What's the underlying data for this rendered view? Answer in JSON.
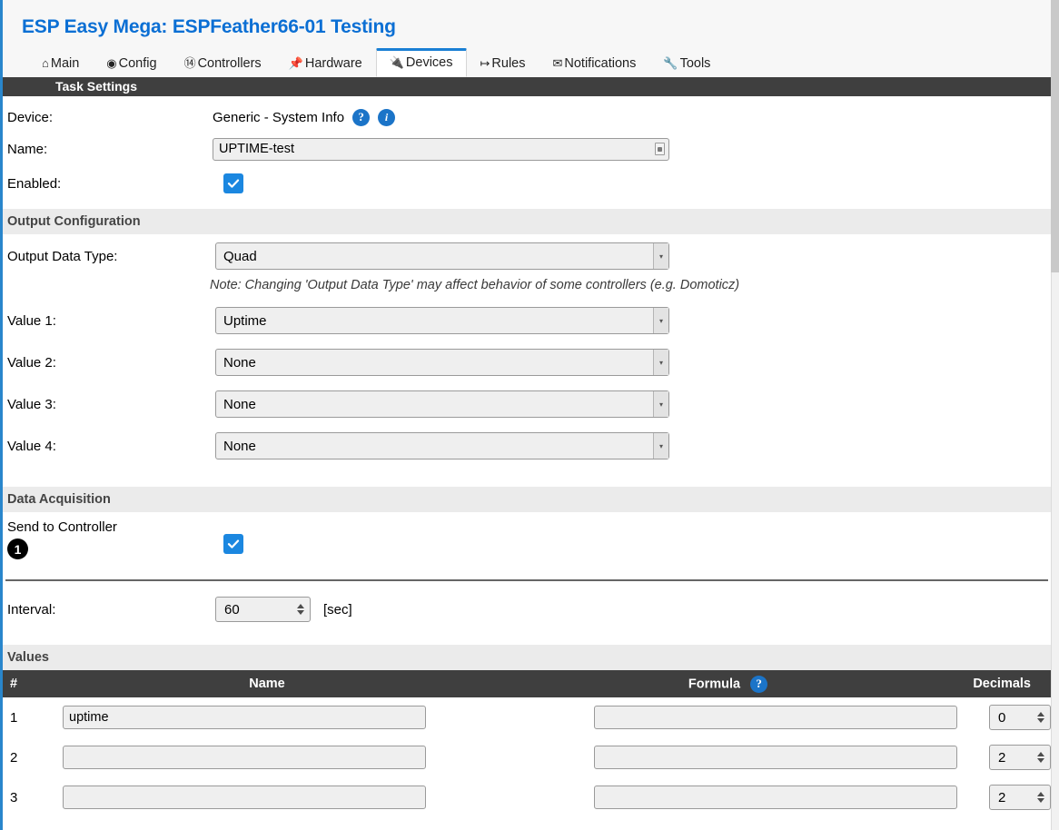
{
  "header": {
    "title": "ESP Easy Mega: ESPFeather66-01 Testing",
    "tabs": [
      {
        "label": "Main",
        "icon": "home-icon",
        "glyph": "⌂",
        "active": false
      },
      {
        "label": "Config",
        "icon": "gear-icon",
        "glyph": "⊙",
        "active": false
      },
      {
        "label": "Controllers",
        "icon": "chat-icon",
        "glyph": "⎕",
        "active": false
      },
      {
        "label": "Hardware",
        "icon": "pin-icon",
        "glyph": "📌",
        "active": false
      },
      {
        "label": "Devices",
        "icon": "plug-icon",
        "glyph": "🔌",
        "active": true
      },
      {
        "label": "Rules",
        "icon": "arrow-branch-icon",
        "glyph": "↦",
        "active": false
      },
      {
        "label": "Notifications",
        "icon": "envelope-icon",
        "glyph": "✉",
        "active": false
      },
      {
        "label": "Tools",
        "icon": "wrench-icon",
        "glyph": "🔧",
        "active": false
      }
    ]
  },
  "task_settings": {
    "bar_label": "Task Settings",
    "device_label": "Device:",
    "device_value": "Generic - System Info",
    "help_badge": "?",
    "info_badge": "i",
    "name_label": "Name:",
    "name_value": "UPTIME-test",
    "name_placeholder": "",
    "enabled_label": "Enabled:",
    "enabled_checked": true
  },
  "output_configuration": {
    "section_label": "Output Configuration",
    "output_data_type_label": "Output Data Type:",
    "output_data_type_value": "Quad",
    "note": "Note: Changing 'Output Data Type' may affect behavior of some controllers (e.g. Domoticz)",
    "values": [
      {
        "label": "Value 1:",
        "value": "Uptime"
      },
      {
        "label": "Value 2:",
        "value": "None"
      },
      {
        "label": "Value 3:",
        "value": "None"
      },
      {
        "label": "Value 4:",
        "value": "None"
      }
    ]
  },
  "data_acquisition": {
    "section_label": "Data Acquisition",
    "send_to_controller_label": "Send to Controller",
    "controller_number": "1",
    "send_to_controller_checked": true,
    "interval_label": "Interval:",
    "interval_value": "60",
    "interval_unit": "[sec]"
  },
  "values_section": {
    "section_label": "Values",
    "columns": {
      "num": "#",
      "name": "Name",
      "formula": "Formula",
      "formula_help": "?",
      "decimals": "Decimals"
    },
    "rows": [
      {
        "num": "1",
        "name": "uptime",
        "formula": "",
        "decimals": "0"
      },
      {
        "num": "2",
        "name": "",
        "formula": "",
        "decimals": "2"
      },
      {
        "num": "3",
        "name": "",
        "formula": "",
        "decimals": "2"
      }
    ]
  },
  "colors": {
    "accent_blue": "#0b6fd4",
    "tab_active_top": "#1a7fd4",
    "dark_bar": "#3f3f3f",
    "section_grey": "#ebebeb",
    "checkbox_blue": "#1b87e0",
    "badge_blue": "#1b74c8"
  }
}
